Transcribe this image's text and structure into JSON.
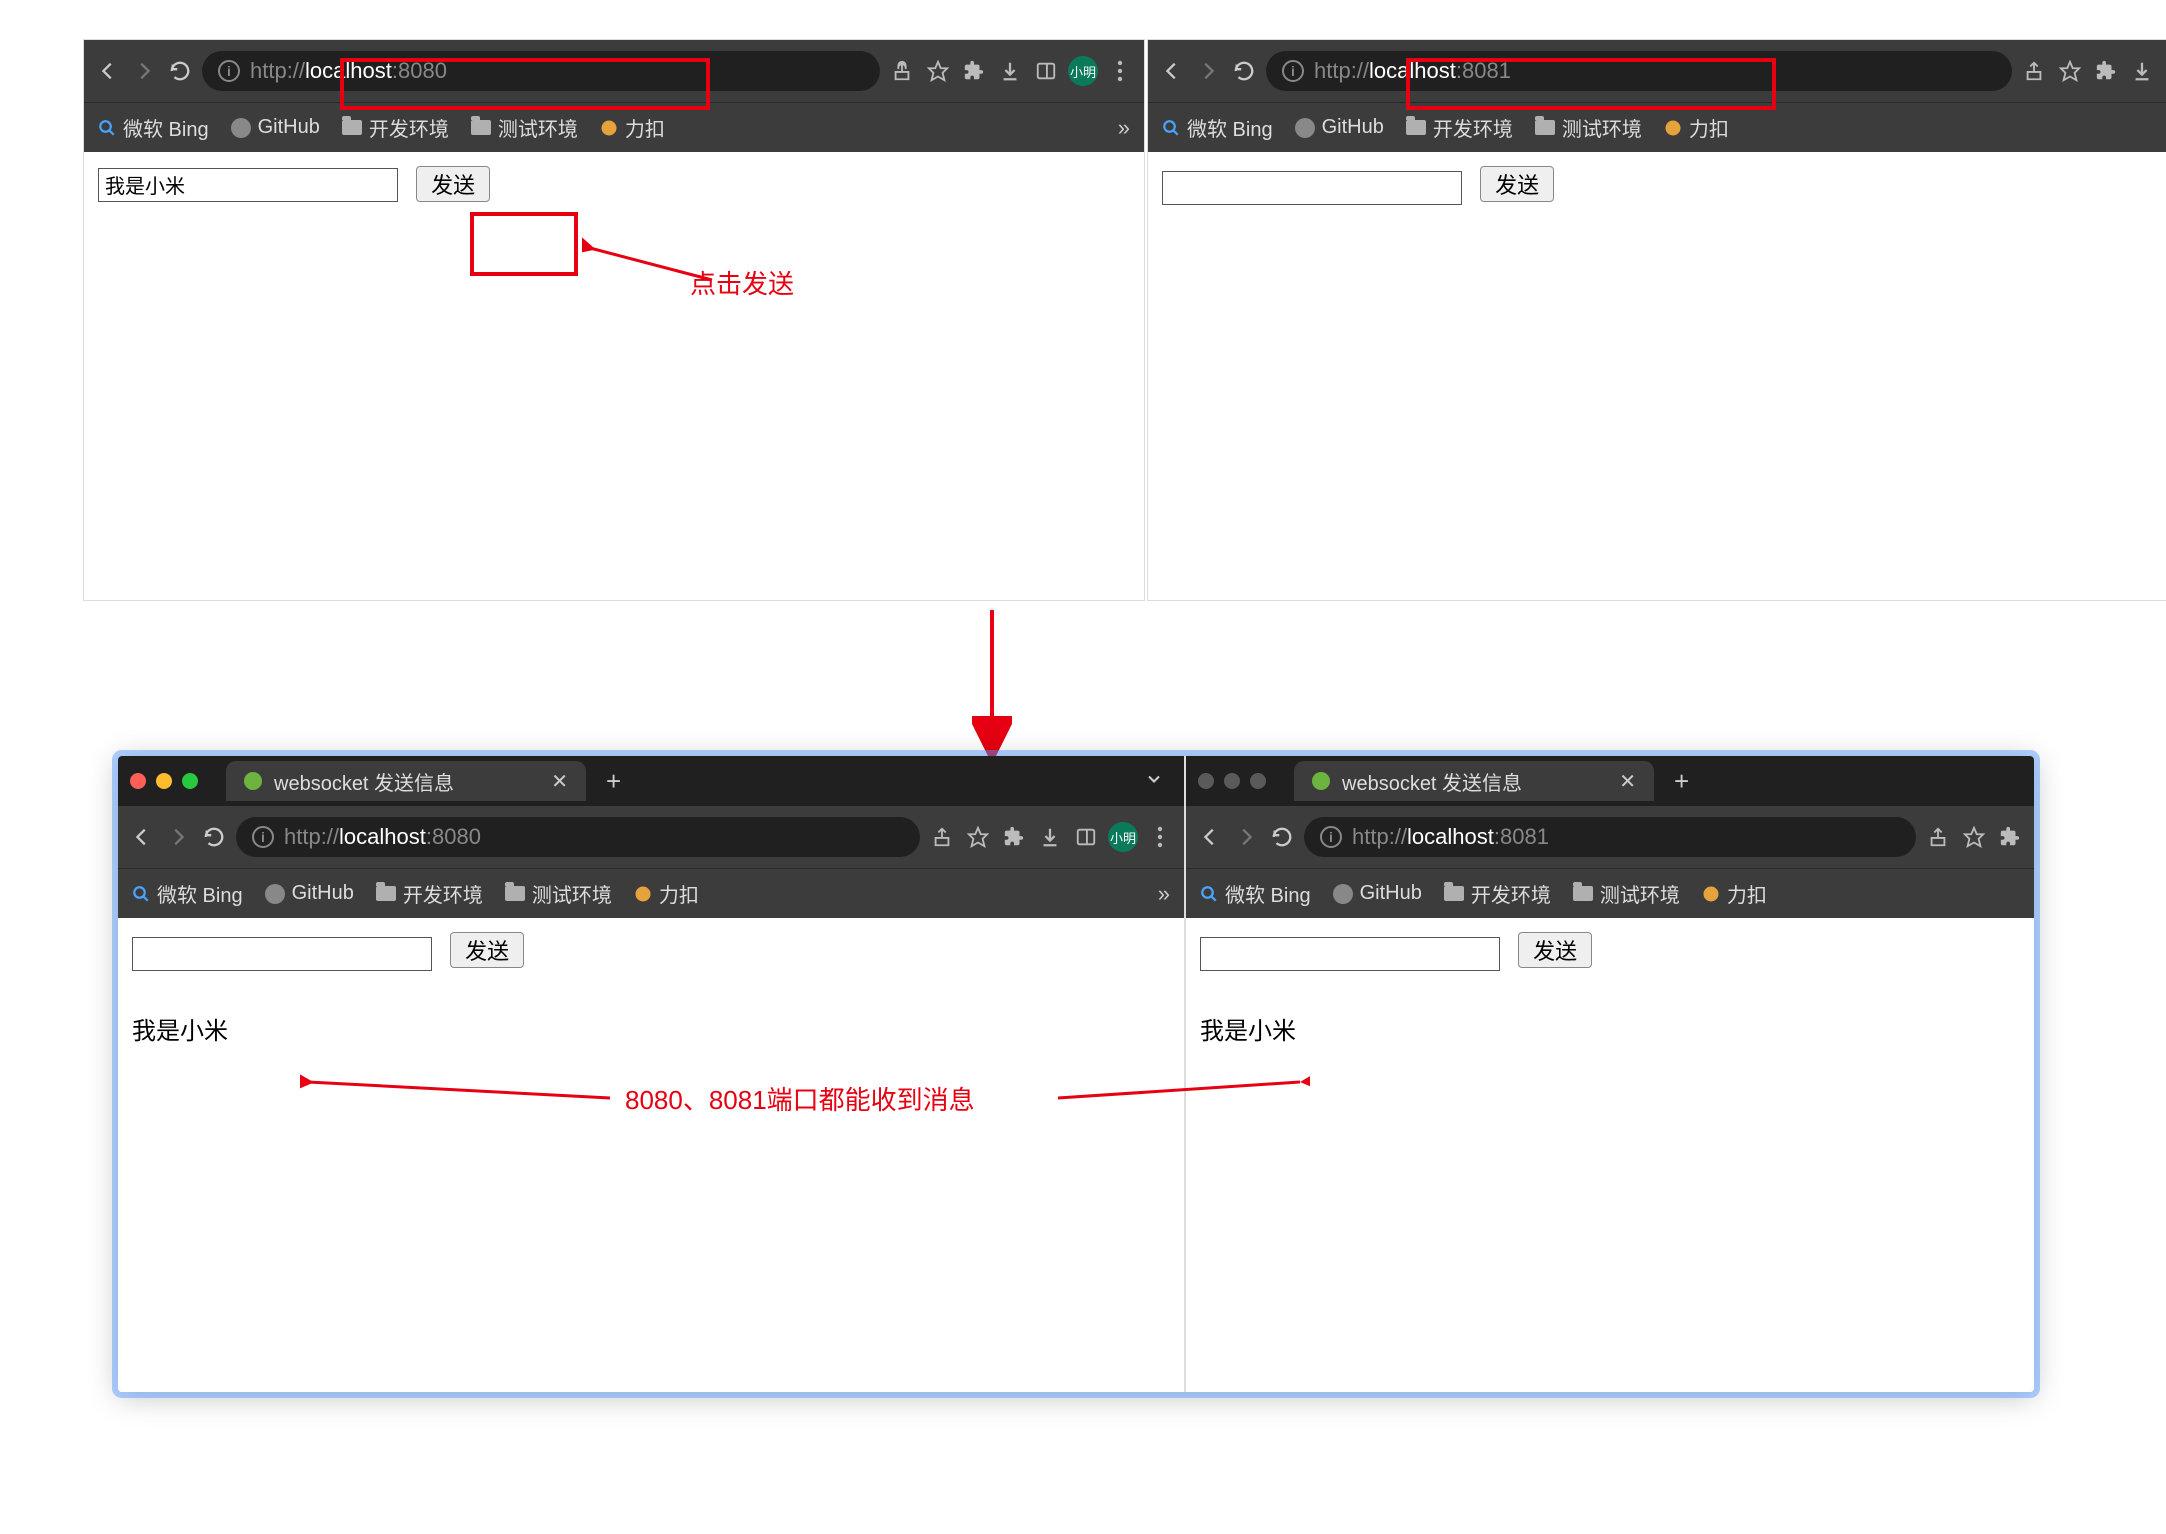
{
  "top_left": {
    "url_prefix": "http://",
    "url_host": "localhost",
    "url_port": ":8080",
    "input_value": "我是小米",
    "send_label": "发送"
  },
  "top_right": {
    "url_prefix": "http://",
    "url_host": "localhost",
    "url_port": ":8081",
    "input_value": "",
    "send_label": "发送"
  },
  "bot_left": {
    "tab_title": "websocket 发送信息",
    "url_prefix": "http://",
    "url_host": "localhost",
    "url_port": ":8080",
    "input_value": "",
    "send_label": "发送",
    "received_msg": "我是小米"
  },
  "bot_right": {
    "tab_title": "websocket 发送信息",
    "url_prefix": "http://",
    "url_host": "localhost",
    "url_port": ":8081",
    "input_value": "",
    "send_label": "发送",
    "received_msg": "我是小米"
  },
  "bookmarks": {
    "bing": "微软 Bing",
    "github": "GitHub",
    "dev_env": "开发环境",
    "test_env": "测试环境",
    "likou": "力扣"
  },
  "avatar_label": "小明",
  "annotations": {
    "click_send": "点击发送",
    "both_receive": "8080、8081端口都能收到消息"
  },
  "chevrons": "»"
}
